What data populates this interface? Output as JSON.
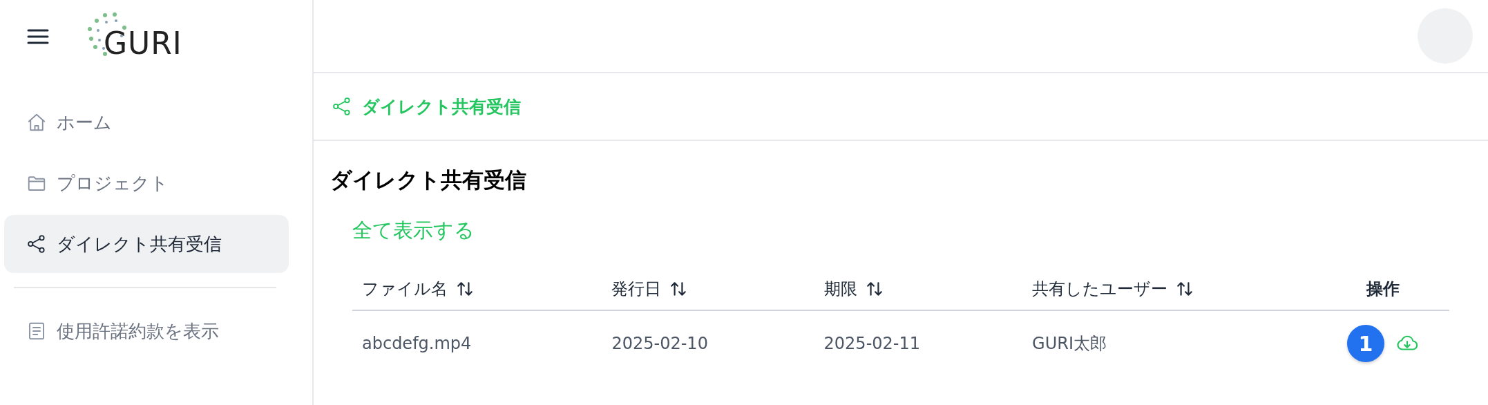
{
  "sidebar": {
    "logo": "GURI",
    "items": [
      {
        "label": "ホーム",
        "kind": "home",
        "selected": false
      },
      {
        "label": "プロジェクト",
        "kind": "folder",
        "selected": false
      },
      {
        "label": "ダイレクト共有受信",
        "kind": "share",
        "selected": true
      }
    ],
    "footer_items": [
      {
        "label": "使用許諾約款を表示",
        "kind": "document"
      }
    ]
  },
  "breadcrumb": {
    "label": "ダイレクト共有受信"
  },
  "page": {
    "title": "ダイレクト共有受信",
    "show_all_link": "全て表示する"
  },
  "table": {
    "columns": [
      {
        "label": "ファイル名",
        "sortable": true
      },
      {
        "label": "発行日",
        "sortable": true
      },
      {
        "label": "期限",
        "sortable": true
      },
      {
        "label": "共有したユーザー",
        "sortable": true
      },
      {
        "label": "操作",
        "sortable": false
      }
    ],
    "rows": [
      {
        "cells": [
          "abcdefg.mp4",
          "2025-02-10",
          "2025-02-11",
          "GURI太郎"
        ],
        "badge": "1"
      }
    ]
  }
}
